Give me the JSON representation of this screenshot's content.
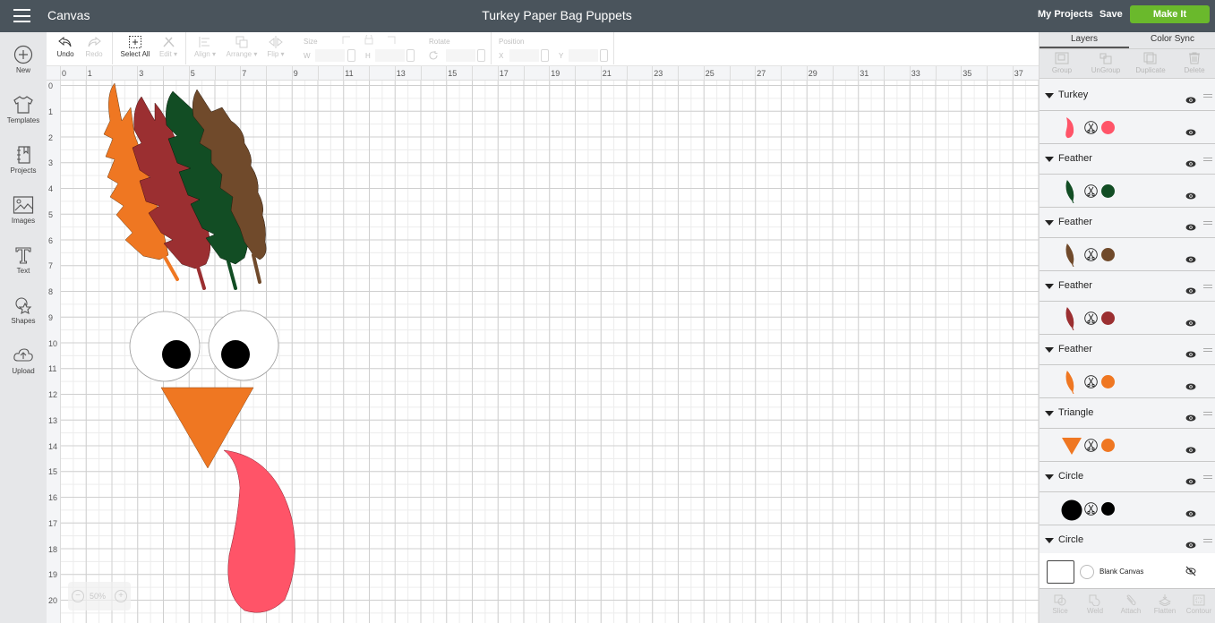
{
  "topbar": {
    "app_title": "Canvas",
    "project_title": "Turkey Paper Bag Puppets",
    "my_projects": "My Projects",
    "save": "Save",
    "make_it": "Make It",
    "accent_color": "#6ab92c"
  },
  "leftnav": {
    "items": [
      {
        "label": "New",
        "icon": "plus-circle-icon"
      },
      {
        "label": "Templates",
        "icon": "tshirt-icon"
      },
      {
        "label": "Projects",
        "icon": "notebook-icon"
      },
      {
        "label": "Images",
        "icon": "image-icon"
      },
      {
        "label": "Text",
        "icon": "text-icon"
      },
      {
        "label": "Shapes",
        "icon": "shapes-icon"
      },
      {
        "label": "Upload",
        "icon": "cloud-upload-icon"
      }
    ]
  },
  "toolbar": {
    "undo": "Undo",
    "redo": "Redo",
    "select_all": "Select All",
    "edit": "Edit",
    "align": "Align",
    "arrange": "Arrange",
    "flip": "Flip",
    "size_label": "Size",
    "w_label": "W",
    "h_label": "H",
    "rotate_label": "Rotate",
    "position_label": "Position",
    "x_label": "X",
    "y_label": "Y"
  },
  "rulers": {
    "horizontal": [
      "0",
      "1",
      "3",
      "5",
      "7",
      "9",
      "11",
      "13",
      "15",
      "17",
      "19",
      "21",
      "23",
      "25",
      "27",
      "29",
      "31",
      "33",
      "35",
      "37"
    ],
    "vertical": [
      "0",
      "1",
      "2",
      "3",
      "4",
      "5",
      "6",
      "7",
      "8",
      "9",
      "10",
      "11",
      "12",
      "13",
      "14",
      "15",
      "16",
      "17",
      "18",
      "19",
      "20"
    ]
  },
  "canvas": {
    "zoom_level": "50%",
    "colors": {
      "orange": "#ef7722",
      "red": "#9b2f31",
      "green": "#124d24",
      "brown": "#704a2b",
      "pink": "#ff5468",
      "black": "#000000",
      "white": "#ffffff"
    }
  },
  "panel": {
    "tabs": [
      "Layers",
      "Color Sync"
    ],
    "active_tab": "Layers",
    "tools": [
      "Group",
      "UnGroup",
      "Duplicate",
      "Delete"
    ],
    "layers": [
      {
        "name": "Turkey",
        "child_thumb": "wattle",
        "color": "#ff5468"
      },
      {
        "name": "Feather",
        "child_thumb": "feather",
        "color": "#124d24"
      },
      {
        "name": "Feather",
        "child_thumb": "feather",
        "color": "#704a2b"
      },
      {
        "name": "Feather",
        "child_thumb": "feather",
        "color": "#9b2f31"
      },
      {
        "name": "Feather",
        "child_thumb": "feather",
        "color": "#ef7722"
      },
      {
        "name": "Triangle",
        "child_thumb": "triangle",
        "color": "#ef7722"
      },
      {
        "name": "Circle",
        "child_thumb": "circle",
        "color": "#000000"
      },
      {
        "name": "Circle",
        "child_thumb": null,
        "color": null
      }
    ],
    "blank_canvas": "Blank Canvas",
    "bottom_tools": [
      "Slice",
      "Weld",
      "Attach",
      "Flatten",
      "Contour"
    ]
  }
}
